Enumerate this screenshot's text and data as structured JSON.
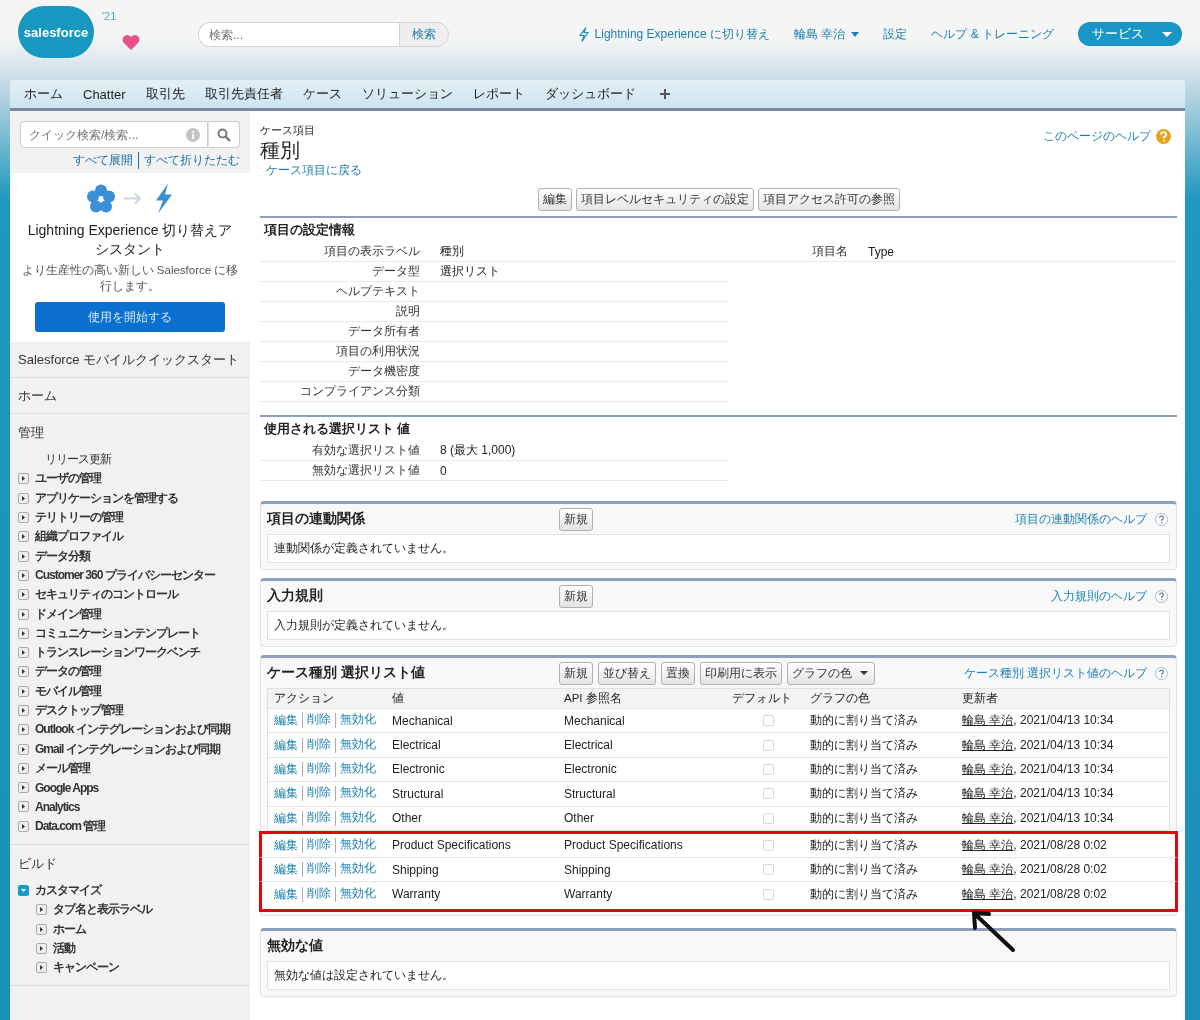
{
  "header": {
    "logo": "salesforce",
    "release": "'21",
    "search": {
      "placeholder": "検索...",
      "button": "検索"
    },
    "links": [
      {
        "kind": "lightning",
        "label": "Lightning Experience に切り替え"
      },
      {
        "kind": "user",
        "label": "輪島 幸治"
      },
      {
        "kind": "plain",
        "label": "設定"
      },
      {
        "kind": "plain",
        "label": "ヘルプ & トレーニング"
      }
    ],
    "app_menu": "サービス"
  },
  "tabs": [
    {
      "label": "ホーム",
      "selected": false
    },
    {
      "label": "Chatter",
      "selected": false
    },
    {
      "label": "取引先",
      "selected": false
    },
    {
      "label": "取引先責任者",
      "selected": false
    },
    {
      "label": "ケース",
      "selected": false
    },
    {
      "label": "ソリューション",
      "selected": false
    },
    {
      "label": "レポート",
      "selected": false
    },
    {
      "label": "ダッシュボード",
      "selected": false
    }
  ],
  "sidebar": {
    "search": {
      "placeholder": "クイック検索/検索..."
    },
    "expand_all": "すべて展開",
    "collapse_all": "すべて折りたたむ",
    "assistant": {
      "title": "Lightning Experience 切り替えアシスタント",
      "text": "より生産性の高い新しい Salesforce に移行します。",
      "button": "使用を開始する"
    },
    "links": [
      "Salesforce モバイルクイックスタート",
      "ホーム"
    ],
    "sections": [
      {
        "title": "管理",
        "items": [
          {
            "label": "リリース更新"
          },
          {
            "label": "ユーザの管理",
            "expanded": false
          },
          {
            "label": "アプリケーションを管理する",
            "expanded": false
          },
          {
            "label": "テリトリーの管理",
            "expanded": false
          },
          {
            "label": "組織プロファイル",
            "expanded": false
          },
          {
            "label": "データ分類",
            "expanded": false
          },
          {
            "label": "Customer 360 プライバシーセンター",
            "expanded": false
          },
          {
            "label": "セキュリティのコントロール",
            "expanded": false
          },
          {
            "label": "ドメイン管理",
            "expanded": false
          },
          {
            "label": "コミュニケーションテンプレート",
            "expanded": false
          },
          {
            "label": "トランスレーションワークベンチ",
            "expanded": false
          },
          {
            "label": "データの管理",
            "expanded": false
          },
          {
            "label": "モバイル管理",
            "expanded": false
          },
          {
            "label": "デスクトップ管理",
            "expanded": false
          },
          {
            "label": "Outlook インテグレーションおよび同期",
            "expanded": false
          },
          {
            "label": "Gmail インテグレーションおよび同期",
            "expanded": false
          },
          {
            "label": "メール管理",
            "expanded": false
          },
          {
            "label": "Google Apps",
            "expanded": false
          },
          {
            "label": "Analytics",
            "expanded": false
          },
          {
            "label": "Data.com 管理",
            "expanded": false
          }
        ]
      },
      {
        "title": "ビルド",
        "items": [
          {
            "label": "カスタマイズ",
            "expanded": true,
            "children": [
              {
                "label": "タブ名と表示ラベル",
                "expanded": false
              },
              {
                "label": "ホーム",
                "expanded": false
              },
              {
                "label": "活動",
                "expanded": false
              },
              {
                "label": "キャンペーン",
                "expanded": false
              }
            ]
          }
        ]
      }
    ]
  },
  "page": {
    "object": "ケース項目",
    "title": "種別",
    "back_link": "ケース項目に戻る",
    "help": "このページのヘルプ",
    "buttons": [
      "編集",
      "項目レベルセキュリティの設定",
      "項目アクセス許可の参照"
    ],
    "detail": {
      "title": "項目の設定情報",
      "rows": [
        {
          "label": "項目の表示ラベル",
          "value": "種別",
          "label_2": "項目名",
          "value_2": "Type"
        },
        {
          "label": "データ型",
          "value": "選択リスト"
        },
        {
          "label": "ヘルプテキスト"
        },
        {
          "label": "説明"
        },
        {
          "label": "データ所有者"
        },
        {
          "label": "項目の利用状況"
        },
        {
          "label": "データ機密度"
        },
        {
          "label": "コンプライアンス分類"
        }
      ]
    },
    "usage": {
      "title": "使用される選択リスト 値",
      "rows": [
        {
          "label": "有効な選択リスト値",
          "value": "8 (最大 1,000)"
        },
        {
          "label": "無効な選択リスト値",
          "value": "0"
        }
      ]
    },
    "related": [
      {
        "title": "項目の連動関係",
        "buttons": [
          "新規"
        ],
        "help": "項目の連動関係のヘルプ",
        "empty": "連動関係が定義されていません。"
      },
      {
        "title": "入力規則",
        "buttons": [
          "新規"
        ],
        "help": "入力規則のヘルプ",
        "empty": "入力規則が定義されていません。"
      }
    ],
    "picklist": {
      "title": "ケース種別 選択リスト値",
      "buttons": [
        "新規",
        "並び替え",
        "置換",
        "印刷用に表示"
      ],
      "dropdown": "グラフの色",
      "help": "ケース種別 選択リスト値のヘルプ",
      "columns": [
        "アクション",
        "値",
        "API 参照名",
        "デフォルト",
        "グラフの色",
        "更新者"
      ],
      "rows": [
        {
          "actions": [
            "編集",
            "削除",
            "無効化"
          ],
          "value": "Mechanical",
          "api": "Mechanical",
          "default": false,
          "graph_color": "動的に割り当て済み",
          "user": "輪島 幸治",
          "date": ", 2021/04/13 10:34",
          "highlighted": false
        },
        {
          "actions": [
            "編集",
            "削除",
            "無効化"
          ],
          "value": "Electrical",
          "api": "Electrical",
          "default": false,
          "graph_color": "動的に割り当て済み",
          "user": "輪島 幸治",
          "date": ", 2021/04/13 10:34",
          "highlighted": false
        },
        {
          "actions": [
            "編集",
            "削除",
            "無効化"
          ],
          "value": "Electronic",
          "api": "Electronic",
          "default": false,
          "graph_color": "動的に割り当て済み",
          "user": "輪島 幸治",
          "date": ", 2021/04/13 10:34",
          "highlighted": false
        },
        {
          "actions": [
            "編集",
            "削除",
            "無効化"
          ],
          "value": "Structural",
          "api": "Structural",
          "default": false,
          "graph_color": "動的に割り当て済み",
          "user": "輪島 幸治",
          "date": ", 2021/04/13 10:34",
          "highlighted": false
        },
        {
          "actions": [
            "編集",
            "削除",
            "無効化"
          ],
          "value": "Other",
          "api": "Other",
          "default": false,
          "graph_color": "動的に割り当て済み",
          "user": "輪島 幸治",
          "date": ", 2021/04/13 10:34",
          "highlighted": false
        },
        {
          "actions": [
            "編集",
            "削除",
            "無効化"
          ],
          "value": "Product Specifications",
          "api": "Product Specifications",
          "default": false,
          "graph_color": "動的に割り当て済み",
          "user": "輪島 幸治",
          "date": ", 2021/08/28 0:02",
          "highlighted": true
        },
        {
          "actions": [
            "編集",
            "削除",
            "無効化"
          ],
          "value": "Shipping",
          "api": "Shipping",
          "default": false,
          "graph_color": "動的に割り当て済み",
          "user": "輪島 幸治",
          "date": ", 2021/08/28 0:02",
          "highlighted": true
        },
        {
          "actions": [
            "編集",
            "削除",
            "無効化"
          ],
          "value": "Warranty",
          "api": "Warranty",
          "default": false,
          "graph_color": "動的に割り当て済み",
          "user": "輪島 幸治",
          "date": ", 2021/08/28 0:02",
          "highlighted": true
        }
      ]
    },
    "inactive": {
      "title": "無効な値",
      "empty": "無効な値は設定されていません。"
    }
  }
}
